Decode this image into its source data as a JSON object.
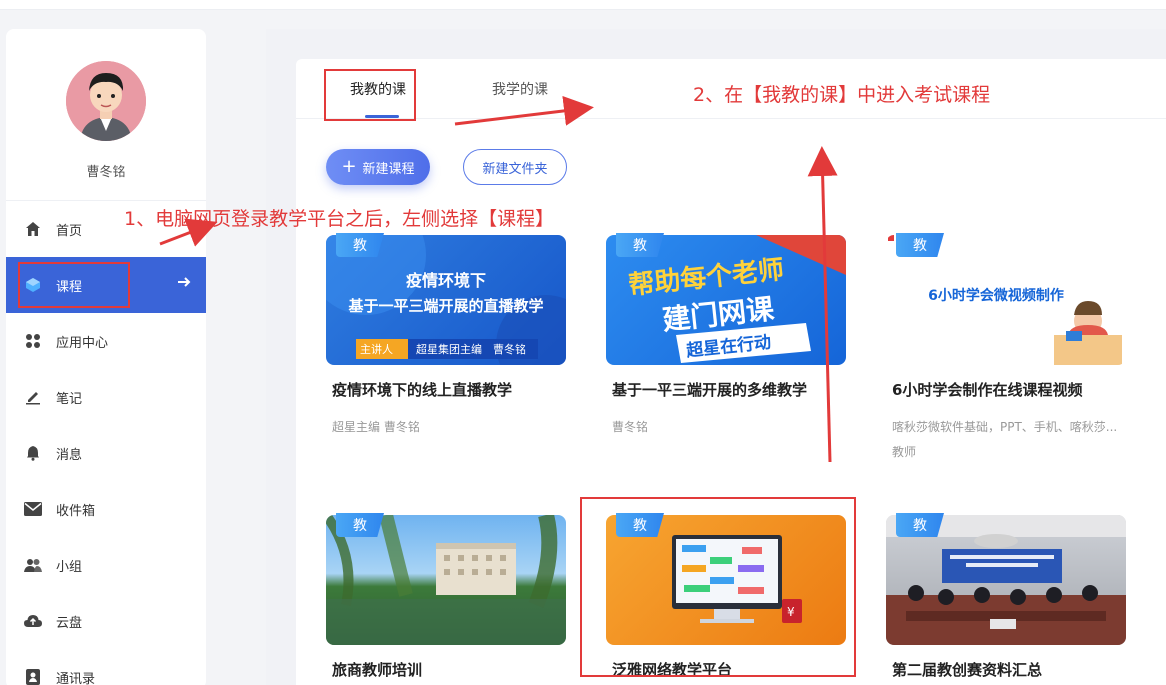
{
  "user": {
    "name": "曹冬铭"
  },
  "sidebar": {
    "items": [
      {
        "label": "首页",
        "icon": "home-icon"
      },
      {
        "label": "课程",
        "icon": "course-icon"
      },
      {
        "label": "应用中心",
        "icon": "apps-icon"
      },
      {
        "label": "笔记",
        "icon": "note-icon"
      },
      {
        "label": "消息",
        "icon": "bell-icon"
      },
      {
        "label": "收件箱",
        "icon": "mail-icon"
      },
      {
        "label": "小组",
        "icon": "group-icon"
      },
      {
        "label": "云盘",
        "icon": "cloud-icon"
      },
      {
        "label": "通讯录",
        "icon": "contacts-icon"
      }
    ],
    "active_index": 1
  },
  "tabs": [
    {
      "label": "我教的课"
    },
    {
      "label": "我学的课"
    }
  ],
  "toolbar": {
    "new_course": "新建课程",
    "new_folder": "新建文件夹"
  },
  "badge_text": "教",
  "courses": [
    {
      "title": "疫情环境下的线上直播教学",
      "sub": "超星主编 曹冬铭",
      "cover_line1": "疫情环境下",
      "cover_line2": "基于一平三端开展的直播教学",
      "cover_tag": "主讲人",
      "cover_tag2": "超星集团主编　曹冬铭"
    },
    {
      "title": "基于一平三端开展的多维教学",
      "sub": "曹冬铭",
      "cover_line1": "帮助每个老师",
      "cover_line2": "建门网课",
      "cover_tag": "超星在行动"
    },
    {
      "title": "6小时学会制作在线课程视频",
      "sub": "喀秋莎微软件基础，PPT、手机、喀秋莎...",
      "sub2": "教师",
      "cover_line1": "6小时学会微视频制作"
    },
    {
      "title": "旅商教师培训"
    },
    {
      "title": "泛雅网络教学平台"
    },
    {
      "title": "第二届教创赛资料汇总"
    }
  ],
  "annotations": {
    "step1": "1、电脑网页登录教学平台之后，左侧选择【课程】",
    "step2": "2、在【我教的课】中进入考试课程"
  },
  "colors": {
    "accent": "#3a64d8",
    "annotation": "#e23a3a",
    "badge": "#2f86ee"
  }
}
